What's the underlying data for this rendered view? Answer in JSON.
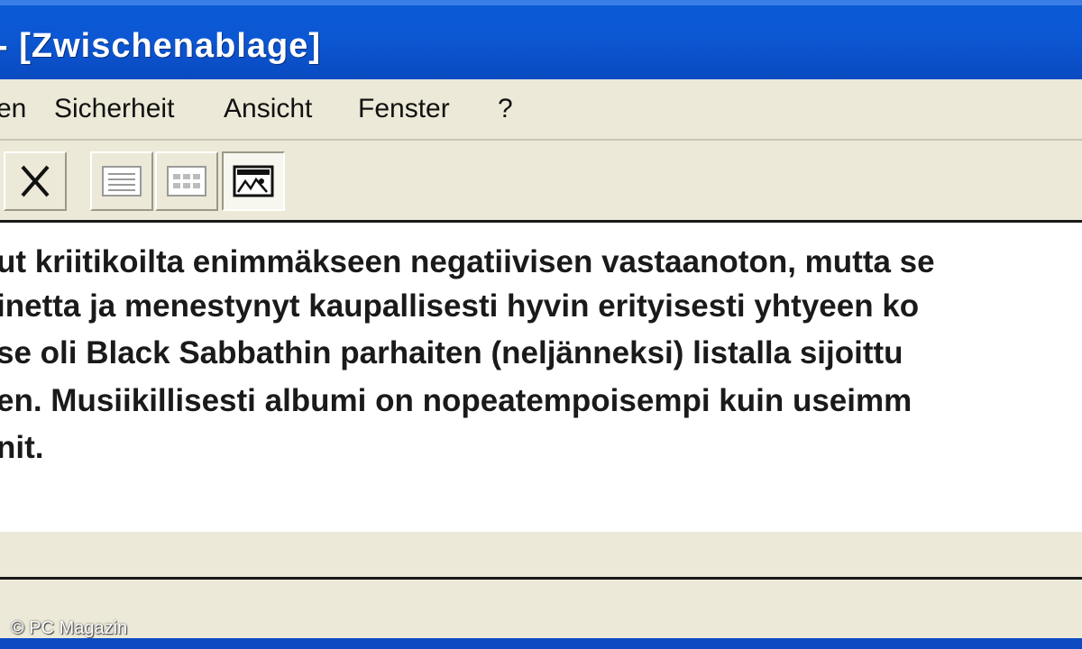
{
  "window": {
    "title": "- [Zwischenablage]"
  },
  "menu": {
    "items": [
      "en",
      "Sicherheit",
      "Ansicht",
      "Fenster",
      "?"
    ]
  },
  "toolbar": {
    "buttons": [
      {
        "icon": "delete-icon"
      },
      {
        "icon": "list-view-icon"
      },
      {
        "icon": "table-view-icon"
      },
      {
        "icon": "image-view-icon"
      }
    ],
    "active": "image-view"
  },
  "content": {
    "lines": [
      "ut kriitikoilta enimmäkseen negatiivisen vastaanoton, mutta se",
      "inetta ja menestynyt kaupallisesti hyvin erityisesti yhtyeen ko",
      "se oli Black Sabbathin parhaiten (neljänneksi) listalla sijoittu",
      "en. Musiikillisesti albumi on nopeatempoisempi kuin useimm",
      "nit."
    ]
  },
  "watermark": "© PC Magazin",
  "colors": {
    "titlebar": "#0a50cc",
    "menubar": "#ece9d8",
    "content": "#ffffff"
  }
}
